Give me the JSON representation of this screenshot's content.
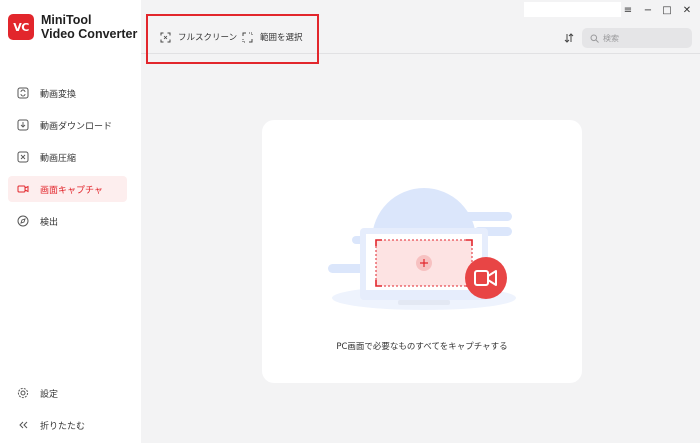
{
  "app": {
    "logo_badge": "VC",
    "name_line1": "MiniTool",
    "name_line2": "Video Converter"
  },
  "sidebar": {
    "items": [
      {
        "label": "動画変換",
        "icon": "convert-icon"
      },
      {
        "label": "動画ダウンロード",
        "icon": "download-icon"
      },
      {
        "label": "動画圧縮",
        "icon": "compress-icon"
      },
      {
        "label": "画面キャプチャ",
        "icon": "screen-capture-icon",
        "active": true
      },
      {
        "label": "検出",
        "icon": "explore-icon"
      }
    ],
    "bottom": [
      {
        "label": "設定",
        "icon": "gear-icon"
      },
      {
        "label": "折りたたむ",
        "icon": "collapse-icon"
      }
    ]
  },
  "window": {
    "menu": "≡",
    "minimize": "−",
    "maximize": "□",
    "close": "✕"
  },
  "toolbar": {
    "fullscreen_label": "フルスクリーン",
    "select_region_label": "範囲を選択",
    "search_placeholder": "検索"
  },
  "main": {
    "empty_message": "PC画面で必要なものすべてをキャプチャする"
  },
  "colors": {
    "accent": "#e2262c",
    "highlight_box": "#e2262c",
    "active_bg": "#fdeeee",
    "background": "#f3f3f4",
    "illustration_blue": "#dbe6fb"
  }
}
